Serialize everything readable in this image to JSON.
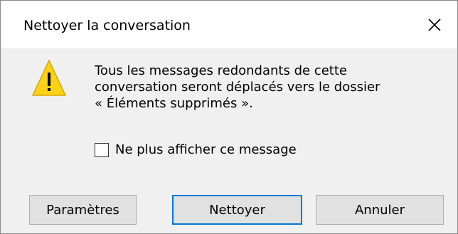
{
  "dialog": {
    "title": "Nettoyer la conversation",
    "close_icon": "close-icon",
    "warning_icon": "warning-icon",
    "message_lines": [
      "Tous les messages redondants de cette",
      "conversation seront déplacés vers le dossier",
      "« Éléments supprimés »."
    ],
    "checkbox": {
      "label": "Ne plus afficher ce message",
      "checked": false
    },
    "buttons": {
      "settings": "Paramètres",
      "clean": "Nettoyer",
      "cancel": "Annuler"
    },
    "colors": {
      "warning_fill": "#FCD116",
      "default_button_border": "#0078D7",
      "background": "#F0F0F0"
    }
  }
}
